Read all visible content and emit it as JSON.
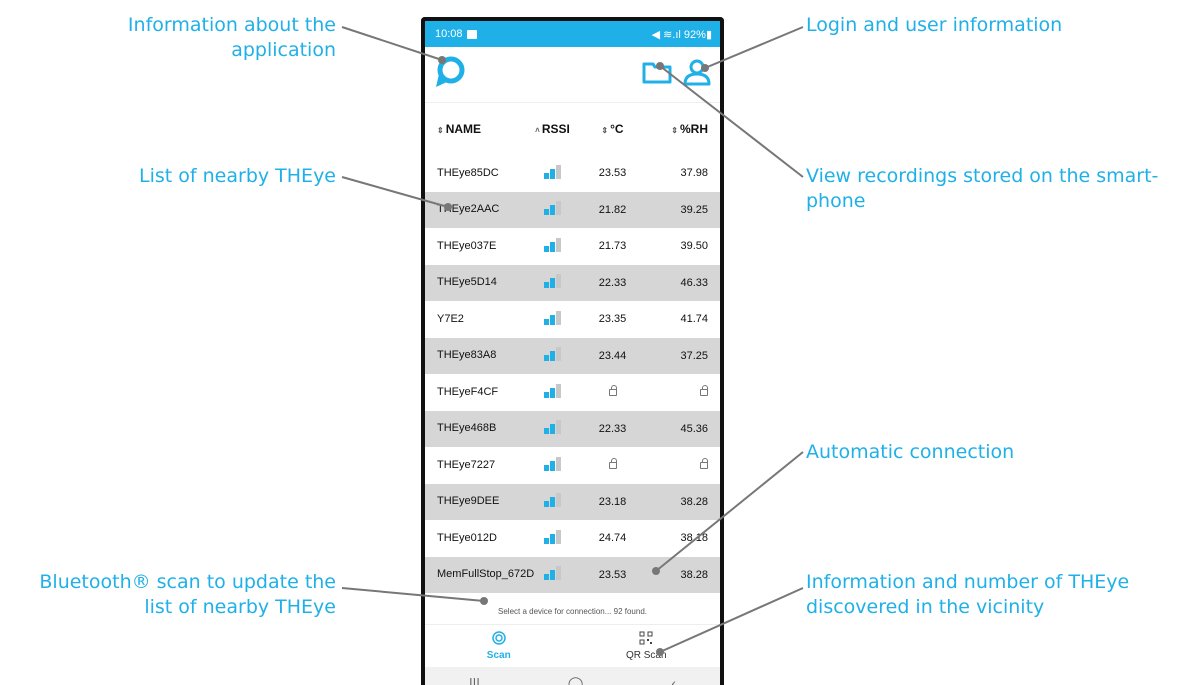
{
  "annotations": {
    "app_info_line1": "Information about the",
    "app_info_line2": "application",
    "list_label": "List of nearby THEye",
    "scan_line1": "Bluetooth® scan to update the",
    "scan_line2": "list of nearby THEye",
    "login_label": "Login and user information",
    "recordings_line1": "View recordings stored on the smart-",
    "recordings_line2": "phone",
    "auto_label": "Automatic connection",
    "discovered_line1": "Information and number of THEye",
    "discovered_line2": "discovered in the vicinity"
  },
  "colors": {
    "accent": "#20b0e8",
    "row_alt": "#d6d6d6",
    "signal_off": "#c8c8c8"
  },
  "status_bar": {
    "time": "10:08",
    "right": "◀ ≋.ıl 92%▮"
  },
  "header": {
    "logo_icon": "app-logo-icon",
    "folder_icon": "folder-icon",
    "user_icon": "user-icon"
  },
  "table": {
    "columns": {
      "name": "NAME",
      "rssi": "RSSI",
      "temp": "°C",
      "rh": "%RH"
    },
    "rows": [
      {
        "name": "THEye85DC",
        "signal": 2,
        "temp": "23.53",
        "rh": "37.98"
      },
      {
        "name": "THEye2AAC",
        "signal": 2,
        "temp": "21.82",
        "rh": "39.25"
      },
      {
        "name": "THEye037E",
        "signal": 2,
        "temp": "21.73",
        "rh": "39.50"
      },
      {
        "name": "THEye5D14",
        "signal": 2,
        "temp": "22.33",
        "rh": "46.33"
      },
      {
        "name": "Y7E2",
        "signal": 2,
        "temp": "23.35",
        "rh": "41.74"
      },
      {
        "name": "THEye83A8",
        "signal": 2,
        "temp": "23.44",
        "rh": "37.25"
      },
      {
        "name": "THEyeF4CF",
        "signal": 2,
        "temp": "",
        "rh": "",
        "locked": true
      },
      {
        "name": "THEye468B",
        "signal": 2,
        "temp": "22.33",
        "rh": "45.36"
      },
      {
        "name": "THEye7227",
        "signal": 2,
        "temp": "",
        "rh": "",
        "locked": true
      },
      {
        "name": "THEye9DEE",
        "signal": 2,
        "temp": "23.18",
        "rh": "38.28"
      },
      {
        "name": "THEye012D",
        "signal": 2,
        "temp": "24.74",
        "rh": "38.18"
      },
      {
        "name": "MemFullStop_672D",
        "signal": 2,
        "temp": "23.53",
        "rh": "38.28"
      }
    ]
  },
  "footer": {
    "status_text": "Select a device for connection... 92 found."
  },
  "tabs": [
    {
      "label": "Scan",
      "icon": "scan-icon",
      "active": true
    },
    {
      "label": "QR Scan",
      "icon": "qr-code-icon",
      "active": false
    }
  ],
  "navbar": {
    "recent": "|||",
    "home": "◯",
    "back": "‹"
  }
}
